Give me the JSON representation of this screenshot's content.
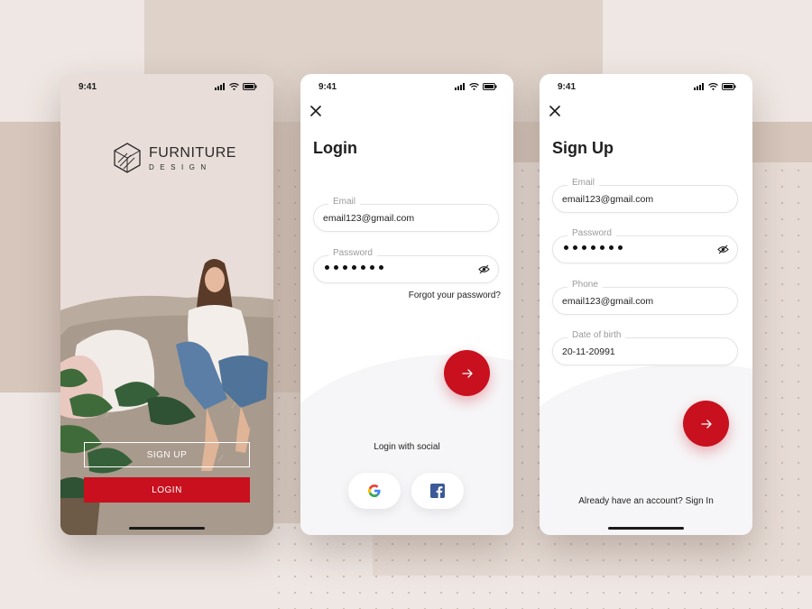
{
  "status": {
    "time": "9:41"
  },
  "welcome": {
    "brand_title": "FURNITURE",
    "brand_subtitle": "DESIGN",
    "signup_label": "SIGN UP",
    "login_label": "LOGIN"
  },
  "login": {
    "title": "Login",
    "email_label": "Email",
    "email_value": "email123@gmail.com",
    "password_label": "Password",
    "forgot_label": "Forgot your password?",
    "social_label": "Login with social"
  },
  "signup": {
    "title": "Sign Up",
    "email_label": "Email",
    "email_value": "email123@gmail.com",
    "password_label": "Password",
    "phone_label": "Phone",
    "phone_value": "email123@gmail.com",
    "dob_label": "Date of birth",
    "dob_value": "20-11-20991",
    "signin_prompt": "Already have an account? Sign In"
  },
  "colors": {
    "accent": "#c8101e",
    "background": "#efe7e3"
  },
  "icons": [
    "close-icon",
    "eye-off-icon",
    "arrow-right-icon",
    "google-icon",
    "facebook-icon",
    "signal-icon",
    "wifi-icon",
    "battery-icon"
  ]
}
